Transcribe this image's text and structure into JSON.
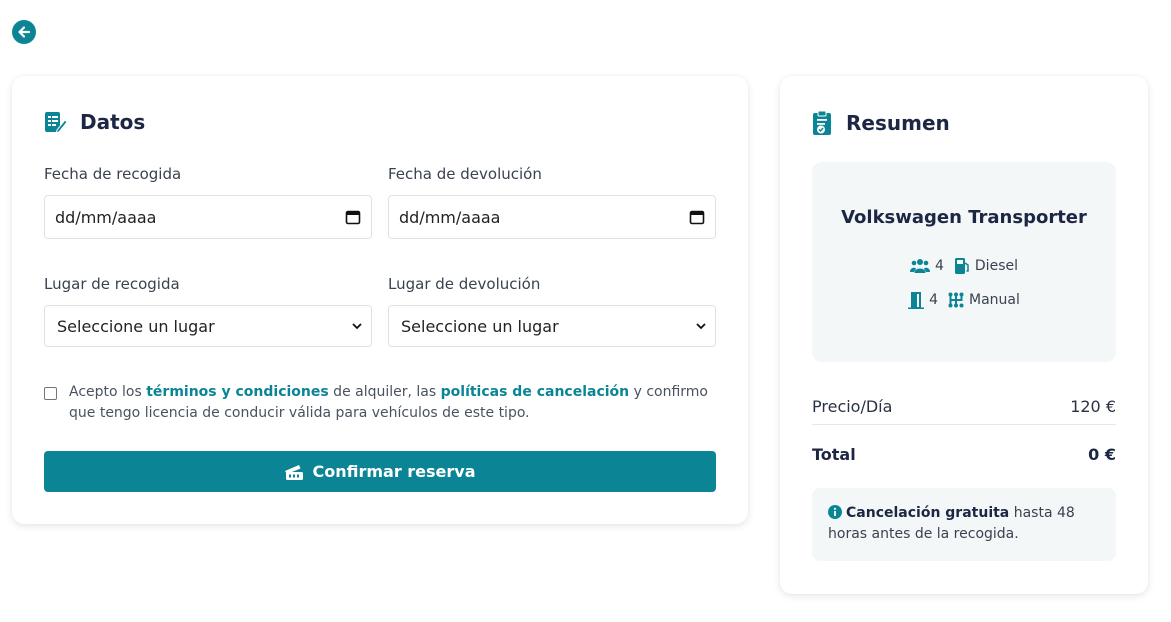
{
  "colors": {
    "accent": "#0b8595",
    "heading": "#1d2744"
  },
  "nav": {
    "back_icon": "arrow-left-circle-icon"
  },
  "datos": {
    "title": "Datos",
    "pickup_date_label": "Fecha de recogida",
    "pickup_date_value": "dd/mm/aaaa",
    "return_date_label": "Fecha de devolución",
    "return_date_value": "dd/mm/aaaa",
    "pickup_place_label": "Lugar de recogida",
    "pickup_place_value": "Seleccione un lugar",
    "return_place_label": "Lugar de devolución",
    "return_place_value": "Seleccione un lugar",
    "terms": {
      "part1": "Acepto los ",
      "link1": "términos y condiciones",
      "part2": " de alquiler, las ",
      "link2": "políticas de cancelación",
      "part3": " y confirmo que tengo licencia de conducir válida para vehículos de este tipo.",
      "checked": false
    },
    "confirm_label": "Confirmar reserva"
  },
  "resumen": {
    "title": "Resumen",
    "vehicle": {
      "name": "Volkswagen Transporter",
      "seats": "4",
      "fuel": "Diesel",
      "doors": "4",
      "transmission": "Manual"
    },
    "price_day_label": "Precio/Día",
    "price_day_value": "120 €",
    "total_label": "Total",
    "total_value": "0 €",
    "note_bold": "Cancelación gratuita",
    "note_text": " hasta 48 horas antes de la recogida."
  }
}
